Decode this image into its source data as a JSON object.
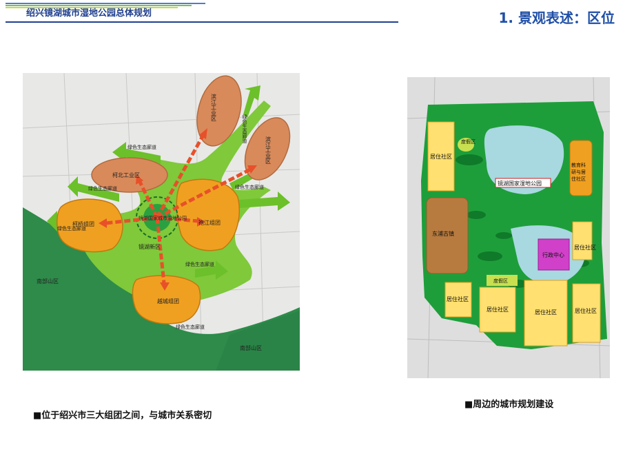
{
  "header": {
    "title": "绍兴镜湖城市湿地公园总体规划",
    "section": "1. 景观表述：区位"
  },
  "left_map": {
    "labels": {
      "binjiang1": "滨江工业区",
      "binjiang2": "滨江工业区",
      "kebei": "柯北工业区",
      "keqiao": "柯桥组团",
      "paojiang": "袍江组团",
      "yuecheng": "越城组团",
      "center": "镜湖国家城市湿地公园",
      "xinqu": "镜湖新区",
      "nanbu1": "南部山区",
      "nanbu2": "南部山区",
      "corr1": "绿色生态廊道",
      "corr2": "绿色生态廊道",
      "corr3": "绿色生态廊道",
      "corr4": "绿色生态廊道",
      "corr5": "绿色生态廊道",
      "corr6": "绿色生态廊道",
      "corr7": "绿色生态廊道"
    },
    "caption": "■位于绍兴市三大组团之间，与城市关系密切"
  },
  "right_map": {
    "labels": {
      "park": "镜湖国家湿地公园",
      "res1": "居住社区",
      "res2": "居住社区",
      "res3": "居住社区",
      "res4": "居住社区",
      "res5": "居住社区",
      "res6": "居住社区",
      "dongpu": "东浦古镇",
      "admin": "行政中心",
      "resort1": "度假区",
      "resort2": "度假区",
      "edu1": "教育科",
      "edu2": "研与居",
      "edu3": "住社区"
    },
    "caption": "■周边的城市规划建设"
  },
  "colors": {
    "title_blue": "#1f3f8f",
    "green_corridor": "#6cc02a",
    "orange_zone": "#f0a020",
    "industry": "#d98a5a",
    "mountain": "#2e8b4a",
    "arrow": "#e8502a"
  }
}
